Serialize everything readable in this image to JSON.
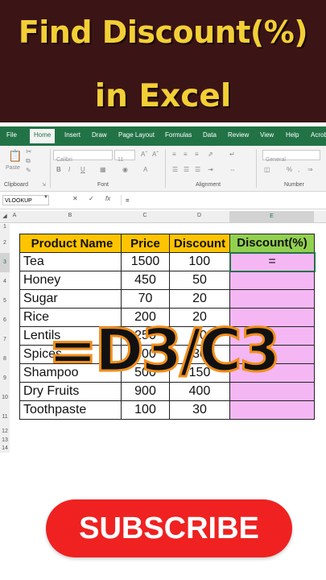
{
  "banner": {
    "line1": "Find Discount(%)",
    "line2": "in Excel"
  },
  "ribbon": {
    "tabs": [
      "File",
      "Home",
      "Insert",
      "Draw",
      "Page Layout",
      "Formulas",
      "Data",
      "Review",
      "View",
      "Help",
      "Acrob"
    ],
    "active_tab": "Home",
    "font_name": "Calibri",
    "font_size": "11",
    "style_box": "General",
    "groups": {
      "clipboard": "Clipboard",
      "font": "Font",
      "alignment": "Alignment",
      "number": "Number"
    },
    "paste_label": "Paste"
  },
  "formula_bar": {
    "name_box": "VLOOKUP",
    "fx_label": "fx",
    "content": "="
  },
  "columns": [
    "A",
    "B",
    "C",
    "D",
    "E"
  ],
  "selected_column": "E",
  "rows": [
    "1",
    "2",
    "3",
    "4",
    "5",
    "6",
    "7",
    "8",
    "9",
    "10",
    "11",
    "12",
    "13",
    "14"
  ],
  "table": {
    "headers": [
      "Product Name",
      "Price",
      "Discount",
      "Discount(%)"
    ],
    "data": [
      [
        "Tea",
        "1500",
        "100",
        "="
      ],
      [
        "Honey",
        "450",
        "50",
        ""
      ],
      [
        "Sugar",
        "70",
        "20",
        ""
      ],
      [
        "Rice",
        "200",
        "20",
        ""
      ],
      [
        "Lentils",
        "250",
        "50",
        ""
      ],
      [
        "Spices",
        "300",
        "30",
        ""
      ],
      [
        "Shampoo",
        "500",
        "150",
        ""
      ],
      [
        "Dry Fruits",
        "900",
        "400",
        ""
      ],
      [
        "Toothpaste",
        "100",
        "30",
        ""
      ]
    ]
  },
  "overlay_formula": "=D3/C3",
  "subscribe_label": "SUBSCRIBE",
  "colors": {
    "banner_bg": "#3b1416",
    "banner_text": "#f3cf36",
    "excel_green": "#217346",
    "header_yellow": "#ffc400",
    "header_green": "#92d050",
    "cell_pink": "#f4b7f4",
    "subscribe_red": "#ef2121",
    "overlay_stroke": "#f18e1b"
  }
}
